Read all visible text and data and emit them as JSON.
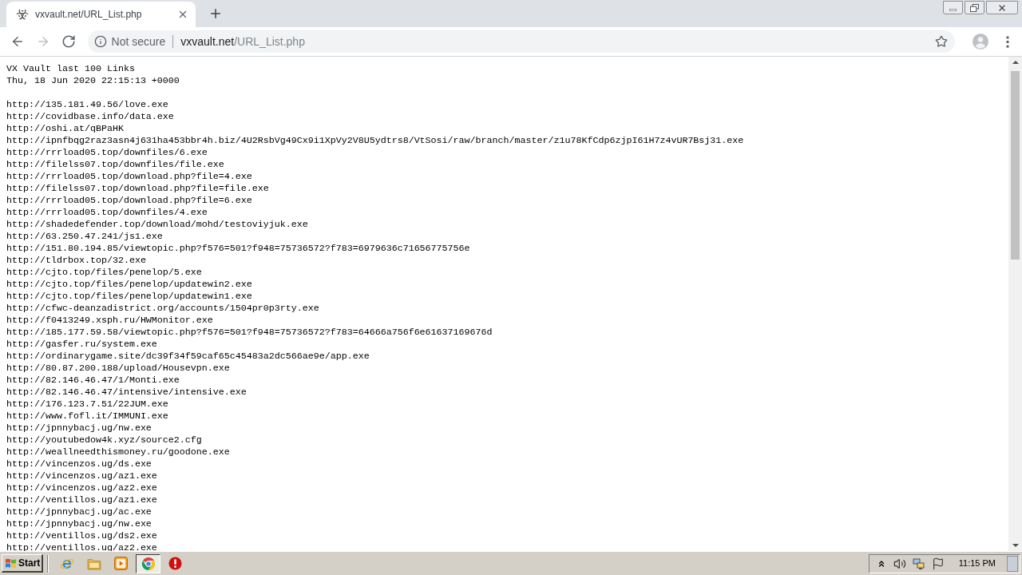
{
  "browser": {
    "tabs": [
      {
        "title": "vxvault.net/URL_List.php",
        "selected": true
      }
    ],
    "nav_buttons": [
      {
        "kind": "back",
        "disabled": false
      },
      {
        "kind": "forward",
        "disabled": true
      },
      {
        "kind": "reload",
        "disabled": false
      }
    ],
    "address_bar": {
      "security_label": "Not secure",
      "host": "vxvault.net",
      "path": "/URL_List.php"
    }
  },
  "page": {
    "title": "VX Vault last 100 Links",
    "timestamp": "Thu, 18 Jun 2020 22:15:13 +0000",
    "links": [
      "http://135.181.49.56/love.exe",
      "http://covidbase.info/data.exe",
      "http://oshi.at/qBPaHK",
      "http://ipnfbqg2raz3asn4j631ha453bbr4h.biz/4U2RsbVg49Cx9i1XpVy2V8U5ydtrs8/VtSosi/raw/branch/master/z1u78KfCdp6zjpI61H7z4vUR7Bsj31.exe",
      "http://rrrload05.top/downfiles/6.exe",
      "http://filelss07.top/downfiles/file.exe",
      "http://rrrload05.top/download.php?file=4.exe",
      "http://filelss07.top/download.php?file=file.exe",
      "http://rrrload05.top/download.php?file=6.exe",
      "http://rrrload05.top/downfiles/4.exe",
      "http://shadedefender.top/download/mohd/testoviyjuk.exe",
      "http://63.250.47.241/js1.exe",
      "http://151.80.194.85/viewtopic.php?f576=501?f948=75736572?f783=6979636c71656775756e",
      "http://tldrbox.top/32.exe",
      "http://cjto.top/files/penelop/5.exe",
      "http://cjto.top/files/penelop/updatewin2.exe",
      "http://cjto.top/files/penelop/updatewin1.exe",
      "http://cfwc-deanzadistrict.org/accounts/1504pr0p3rty.exe",
      "http://f0413249.xsph.ru/HWMonitor.exe",
      "http://185.177.59.58/viewtopic.php?f576=501?f948=75736572?f783=64666a756f6e61637169676d",
      "http://gasfer.ru/system.exe",
      "http://ordinarygame.site/dc39f34f59caf65c45483a2dc566ae9e/app.exe",
      "http://80.87.200.188/upload/Housevpn.exe",
      "http://82.146.46.47/1/Monti.exe",
      "http://82.146.46.47/intensive/intensive.exe",
      "http://176.123.7.51/22JUM.exe",
      "http://www.fofl.it/IMMUNI.exe",
      "http://jpnnybacj.ug/nw.exe",
      "http://youtubedow4k.xyz/source2.cfg",
      "http://weallneedthismoney.ru/goodone.exe",
      "http://vincenzos.ug/ds.exe",
      "http://vincenzos.ug/az1.exe",
      "http://vincenzos.ug/az2.exe",
      "http://ventillos.ug/az1.exe",
      "http://jpnnybacj.ug/ac.exe",
      "http://jpnnybacj.ug/nw.exe",
      "http://ventillos.ug/ds2.exe",
      "http://ventillos.ug/az2.exe"
    ]
  },
  "taskbar": {
    "start_label": "Start",
    "apps": [
      {
        "kind": "ie",
        "selected": false
      },
      {
        "kind": "explorer",
        "selected": false
      },
      {
        "kind": "media",
        "selected": false
      },
      {
        "kind": "chrome",
        "selected": true
      },
      {
        "kind": "alert",
        "selected": false
      }
    ],
    "clock": "11:15 PM"
  }
}
